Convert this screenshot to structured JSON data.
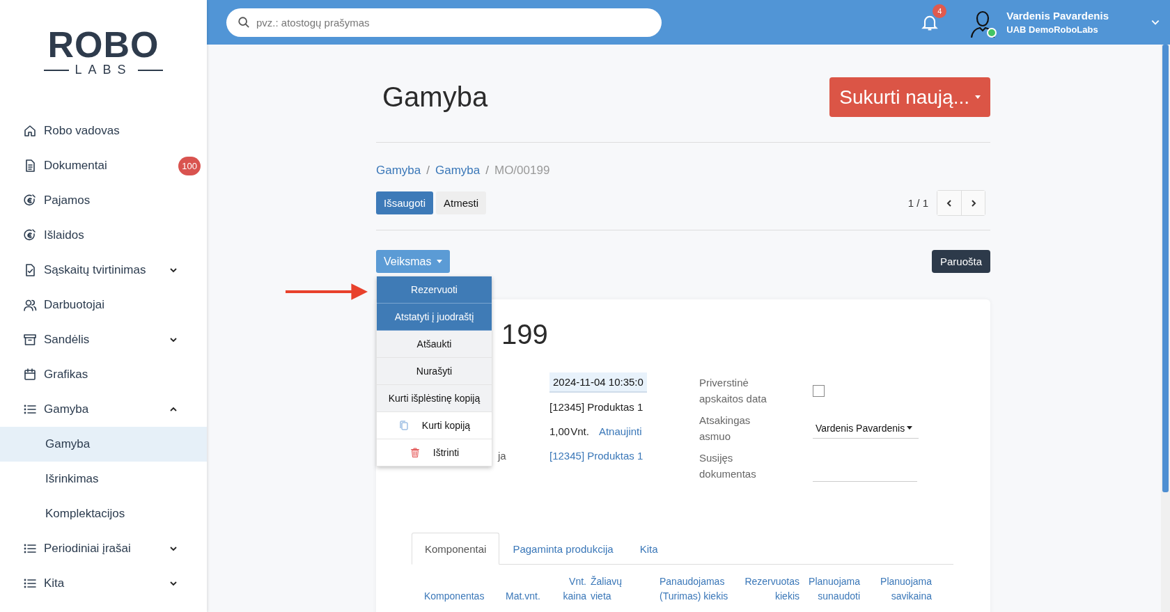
{
  "sidebar": {
    "logo": {
      "top": "ROBO",
      "bottom": "LABS"
    },
    "items": [
      {
        "label": "Robo vadovas",
        "selected": false
      },
      {
        "label": "Dokumentai",
        "selected": false,
        "badge": "100"
      },
      {
        "label": "Pajamos",
        "selected": false
      },
      {
        "label": "Išlaidos",
        "selected": false
      },
      {
        "label": "Sąskaitų tvirtinimas",
        "selected": false,
        "expanded": false
      },
      {
        "label": "Darbuotojai",
        "selected": false
      },
      {
        "label": "Sandėlis",
        "selected": false,
        "expanded": false
      },
      {
        "label": "Grafikas",
        "selected": false
      },
      {
        "label": "Gamyba",
        "selected": false,
        "expanded": true,
        "children": [
          {
            "label": "Gamyba",
            "selected": true
          },
          {
            "label": "Išrinkimas",
            "selected": false
          },
          {
            "label": "Komplektacijos",
            "selected": false
          }
        ]
      },
      {
        "label": "Periodiniai įrašai",
        "selected": false,
        "expanded": false
      },
      {
        "label": "Kita",
        "selected": false,
        "expanded": false
      }
    ]
  },
  "topbar": {
    "search": {
      "placeholder": "pvz.: atostogų prašymas"
    },
    "notifications": "4",
    "user": {
      "name": "Vardenis Pavardenis",
      "company": "UAB DemoRoboLabs",
      "online": true
    }
  },
  "page": {
    "title": "Gamyba",
    "create_button": "Sukurti naują...",
    "breadcrumb": [
      {
        "label": "Gamyba",
        "link": true
      },
      {
        "label": "Gamyba",
        "link": true
      },
      {
        "label": "MO/00199",
        "link": false
      }
    ],
    "separator": "/",
    "buttons": [
      {
        "label": "Išsaugoti",
        "kind": "primary"
      },
      {
        "label": "Atmesti",
        "kind": "secondary"
      }
    ],
    "pager": "1 / 1",
    "action_button": "Veiksmas",
    "status": "Paruošta",
    "action_menu": [
      {
        "label": "Rezervuoti",
        "kind": "highlighted"
      },
      {
        "label": "Atstatyti į juodraštį",
        "kind": "highlighted"
      },
      {
        "label": "Atšaukti",
        "kind": "plain"
      },
      {
        "label": "Nurašyti",
        "kind": "plain"
      },
      {
        "label": "Kurti išplėstinę kopiją",
        "kind": "plain"
      },
      {
        "label": "Kurti kopiją",
        "kind": "copy"
      },
      {
        "label": "Ištrinti",
        "kind": "delete"
      }
    ]
  },
  "card": {
    "title": "199",
    "rows": [
      {
        "kind": "date",
        "value": "2024-11-04 10:35:0"
      },
      {
        "kind": "text",
        "value": "[12345] Produktas 1"
      },
      {
        "kind": "quantity",
        "value": "1,00",
        "unit": "Vnt.",
        "link": "Atnaujinti"
      },
      {
        "kind": "link",
        "label": "ja",
        "value": "[12345] Produktas 1"
      }
    ],
    "fields": [
      {
        "label": "Priverstinė apskaitos data",
        "kind": "checkbox",
        "checked": false
      },
      {
        "label": "Atsakingas asmuo",
        "kind": "select",
        "value": "Vardenis Pavardenis"
      },
      {
        "label": "Susijęs dokumentas",
        "kind": "input"
      }
    ],
    "tabs": [
      {
        "label": "Komponentai",
        "selected": true
      },
      {
        "label": "Pagaminta produkcija",
        "selected": false
      },
      {
        "label": "Kita",
        "selected": false
      }
    ],
    "table": {
      "columns": [
        [
          "Komponentas"
        ],
        [
          "Mat.vnt."
        ],
        [
          "Vnt.",
          "kaina"
        ],
        [
          "Žaliavų",
          "vieta"
        ],
        [
          "Panaudojamas",
          "(Turimas) kiekis"
        ],
        [
          "Rezervuotas",
          "kiekis"
        ],
        [
          "Planuojama",
          "sunaudoti"
        ],
        [
          "Planuojama",
          "savikaina"
        ]
      ]
    }
  }
}
